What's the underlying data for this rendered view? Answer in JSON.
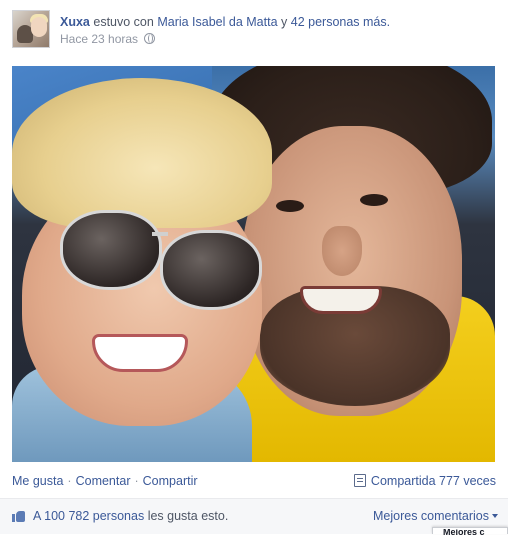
{
  "post": {
    "author": "Xuxa",
    "action_text": "estuvo con",
    "tagged_person": "Maria Isabel da Matta",
    "connector": "y",
    "others_link": "42 personas más.",
    "timestamp": "Hace 23 horas",
    "privacy_icon": "globe-icon"
  },
  "actions": {
    "like": "Me gusta",
    "comment": "Comentar",
    "share": "Compartir",
    "separator": "·",
    "shares_count": "Compartida 777 veces"
  },
  "likes": {
    "count_link": "A 100 782 personas",
    "suffix": "les gusta esto.",
    "sort_label": "Mejores comentarios",
    "dropdown_peek": "Mejores c"
  },
  "colors": {
    "link": "#3b5998",
    "muted": "#9197a3",
    "bar_bg": "#f6f7f9"
  }
}
